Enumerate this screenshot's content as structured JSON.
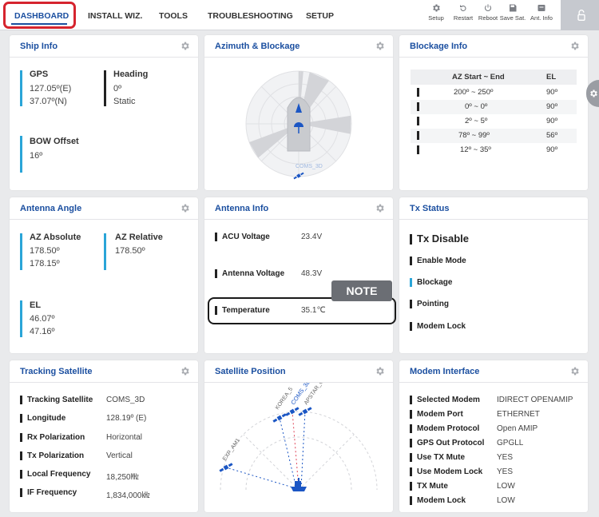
{
  "nav": {
    "tabs": [
      {
        "label": "DASHBOARD",
        "active": true
      },
      {
        "label": "INSTALL WIZ."
      },
      {
        "label": "TOOLS"
      },
      {
        "label": "TROUBLESHOOTING"
      },
      {
        "label": "SETUP"
      }
    ],
    "toolbar": [
      {
        "label": "Setup",
        "icon": "gear-icon"
      },
      {
        "label": "Restart",
        "icon": "restart-icon"
      },
      {
        "label": "Reboot",
        "icon": "power-icon"
      },
      {
        "label": "Save Sat.",
        "icon": "save-icon"
      },
      {
        "label": "Ant. Info",
        "icon": "info-icon"
      }
    ],
    "lock_icon": "lock-icon",
    "highlight_color": "#d6242e"
  },
  "ship_info": {
    "title": "Ship Info",
    "gps_label": "GPS",
    "gps_lon": "127.05º(E)",
    "gps_lat": "37.07º(N)",
    "heading_label": "Heading",
    "heading_value": "0º",
    "heading_mode": "Static",
    "bow_label": "BOW Offset",
    "bow_value": "16º"
  },
  "azimuth": {
    "title": "Azimuth & Blockage",
    "satellite_label": "COMS_3D"
  },
  "blockage_info": {
    "title": "Blockage Info",
    "headers": [
      "AZ Start ~ End",
      "EL"
    ],
    "rows": [
      {
        "range": "200º ~ 250º",
        "el": "90º"
      },
      {
        "range": "0º ~ 0º",
        "el": "90º"
      },
      {
        "range": "2º ~ 5º",
        "el": "90º"
      },
      {
        "range": "78º ~ 99º",
        "el": "56º"
      },
      {
        "range": "12º ~ 35º",
        "el": "90º"
      }
    ]
  },
  "antenna_angle": {
    "title": "Antenna Angle",
    "az_abs_label": "AZ Absolute",
    "az_abs_1": "178.50º",
    "az_abs_2": "178.15º",
    "az_rel_label": "AZ Relative",
    "az_rel_value": "178.50º",
    "el_label": "EL",
    "el_1": "46.07º",
    "el_2": "47.16º"
  },
  "antenna_info": {
    "title": "Antenna Info",
    "rows": [
      {
        "label": "ACU Voltage",
        "value": "23.4V"
      },
      {
        "label": "Antenna Voltage",
        "value": "48.3V"
      },
      {
        "label": "Temperature",
        "value": "35.1℃"
      }
    ],
    "note": "NOTE"
  },
  "tx_status": {
    "title": "Tx Status",
    "main": "Tx Disable",
    "items": [
      {
        "label": "Enable Mode",
        "active": false
      },
      {
        "label": "Blockage",
        "active": true
      },
      {
        "label": "Pointing",
        "active": false
      },
      {
        "label": "Modem Lock",
        "active": false
      }
    ]
  },
  "tracking": {
    "title": "Tracking Satellite",
    "rows": [
      {
        "label": "Tracking Satellite",
        "value": "COMS_3D"
      },
      {
        "label": "Longitude",
        "value": "128.19º (E)"
      },
      {
        "label": "Rx Polarization",
        "value": "Horizontal"
      },
      {
        "label": "Tx Polarization",
        "value": "Vertical"
      },
      {
        "label": "Local Frequency",
        "value": "18,250㎒"
      },
      {
        "label": "IF Frequency",
        "value": "1,834,000㎑"
      }
    ]
  },
  "sat_position": {
    "title": "Satellite Position",
    "satellites": [
      "KOREA_5",
      "COMS_3D",
      "APSTAR_6",
      "EXP_AM1"
    ]
  },
  "modem": {
    "title": "Modem Interface",
    "rows": [
      {
        "label": "Selected Modem",
        "value": "IDIRECT OPENAMIP"
      },
      {
        "label": "Modem Port",
        "value": "ETHERNET"
      },
      {
        "label": "Modem Protocol",
        "value": "Open AMIP"
      },
      {
        "label": "GPS Out Protocol",
        "value": "GPGLL"
      },
      {
        "label": "Use TX Mute",
        "value": "YES"
      },
      {
        "label": "Use Modem Lock",
        "value": "YES"
      },
      {
        "label": "TX Mute",
        "value": "LOW"
      },
      {
        "label": "Modem Lock",
        "value": "LOW"
      }
    ]
  },
  "colors": {
    "accent": "#1b4fa0",
    "status_blue": "#2aa5d8",
    "satellite": "#1b56c4"
  }
}
